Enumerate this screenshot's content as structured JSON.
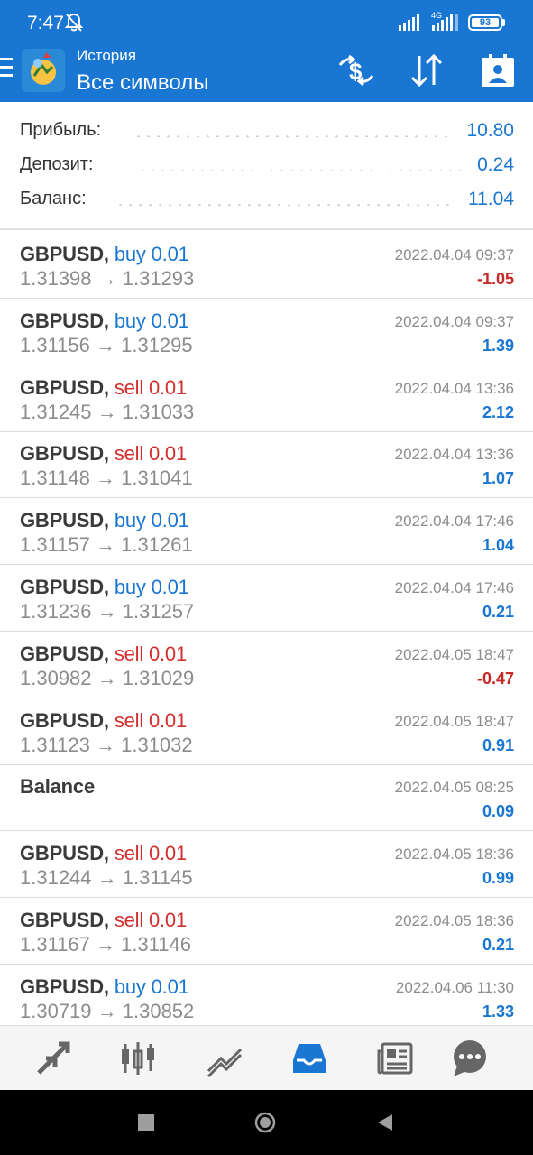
{
  "status": {
    "time": "7:47",
    "network": "4G",
    "battery": "93"
  },
  "header": {
    "subtitle": "История",
    "title": "Все символы"
  },
  "summary": [
    {
      "label": "Прибыль:",
      "value": "10.80"
    },
    {
      "label": "Депозит:",
      "value": "0.24"
    },
    {
      "label": "Баланс:",
      "value": "11.04"
    }
  ],
  "deals": [
    {
      "symbol": "GBPUSD,",
      "dir": "buy 0.01",
      "type": "buy",
      "prices": "1.31398 → 1.31293",
      "time": "2022.04.04 09:37",
      "pl": "-1.05"
    },
    {
      "symbol": "GBPUSD,",
      "dir": "buy 0.01",
      "type": "buy",
      "prices": "1.31156 → 1.31295",
      "time": "2022.04.04 09:37",
      "pl": "1.39"
    },
    {
      "symbol": "GBPUSD,",
      "dir": "sell 0.01",
      "type": "sell",
      "prices": "1.31245 → 1.31033",
      "time": "2022.04.04 13:36",
      "pl": "2.12"
    },
    {
      "symbol": "GBPUSD,",
      "dir": "sell 0.01",
      "type": "sell",
      "prices": "1.31148 → 1.31041",
      "time": "2022.04.04 13:36",
      "pl": "1.07"
    },
    {
      "symbol": "GBPUSD,",
      "dir": "buy 0.01",
      "type": "buy",
      "prices": "1.31157 → 1.31261",
      "time": "2022.04.04 17:46",
      "pl": "1.04"
    },
    {
      "symbol": "GBPUSD,",
      "dir": "buy 0.01",
      "type": "buy",
      "prices": "1.31236 → 1.31257",
      "time": "2022.04.04 17:46",
      "pl": "0.21"
    },
    {
      "symbol": "GBPUSD,",
      "dir": "sell 0.01",
      "type": "sell",
      "prices": "1.30982 → 1.31029",
      "time": "2022.04.05 18:47",
      "pl": "-0.47"
    },
    {
      "symbol": "GBPUSD,",
      "dir": "sell 0.01",
      "type": "sell",
      "prices": "1.31123 → 1.31032",
      "time": "2022.04.05 18:47",
      "pl": "0.91"
    },
    {
      "symbol": "Balance",
      "dir": "",
      "type": "balance",
      "prices": "",
      "time": "2022.04.05 08:25",
      "pl": "0.09"
    },
    {
      "symbol": "GBPUSD,",
      "dir": "sell 0.01",
      "type": "sell",
      "prices": "1.31244 → 1.31145",
      "time": "2022.04.05 18:36",
      "pl": "0.99"
    },
    {
      "symbol": "GBPUSD,",
      "dir": "sell 0.01",
      "type": "sell",
      "prices": "1.31167 → 1.31146",
      "time": "2022.04.05 18:36",
      "pl": "0.21"
    },
    {
      "symbol": "GBPUSD,",
      "dir": "buy 0.01",
      "type": "buy",
      "prices": "1.30719 → 1.30852",
      "time": "2022.04.06 11:30",
      "pl": "1.33"
    }
  ],
  "toolbar_icons": [
    "currency-exchange-icon",
    "sort-icon",
    "report-icon"
  ],
  "nav_icons": [
    "quotes-icon",
    "chart-candles-icon",
    "trade-icon",
    "history-icon",
    "news-icon",
    "chat-icon"
  ],
  "active_nav": "history-icon",
  "colors": {
    "primary": "#1976d2",
    "loss": "#c62828",
    "sell": "#d32f2f"
  }
}
